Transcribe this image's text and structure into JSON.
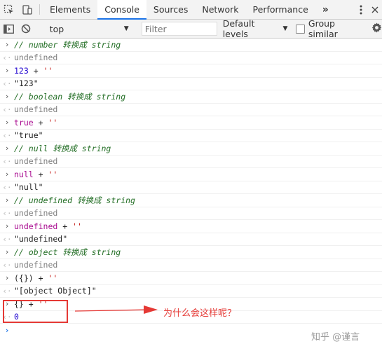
{
  "tabs": {
    "items": [
      "Elements",
      "Console",
      "Sources",
      "Network",
      "Performance"
    ],
    "active_index": 1,
    "more": "»"
  },
  "toolbar": {
    "context": "top",
    "filter_placeholder": "Filter",
    "levels": "Default levels",
    "group_similar": "Group similar"
  },
  "console": [
    {
      "comment": "// number 转换成 string",
      "result": "undefined",
      "input": [
        "123",
        " + ",
        "''"
      ],
      "output": "\"123\""
    },
    {
      "comment": "// boolean 转换成 string",
      "result": "undefined",
      "input": [
        "true",
        " + ",
        "''"
      ],
      "output": "\"true\""
    },
    {
      "comment": "// null 转换成 string",
      "result": "undefined",
      "input": [
        "null",
        " + ",
        "''"
      ],
      "output": "\"null\""
    },
    {
      "comment": "// undefined 转换成 string",
      "result": "undefined",
      "input": [
        "undefined",
        " + ",
        "''"
      ],
      "output": "\"undefined\""
    },
    {
      "comment": "// object 转换成 string",
      "result": "undefined",
      "input": [
        "({})",
        " + ",
        "''"
      ],
      "output": "\"[object Object]\""
    }
  ],
  "highlight": {
    "input": [
      "{}",
      " + ",
      "''"
    ],
    "output": "0"
  },
  "annotation": {
    "note": "为什么会这样呢？",
    "color": "#e53935"
  },
  "watermark": "知乎 @谨言"
}
